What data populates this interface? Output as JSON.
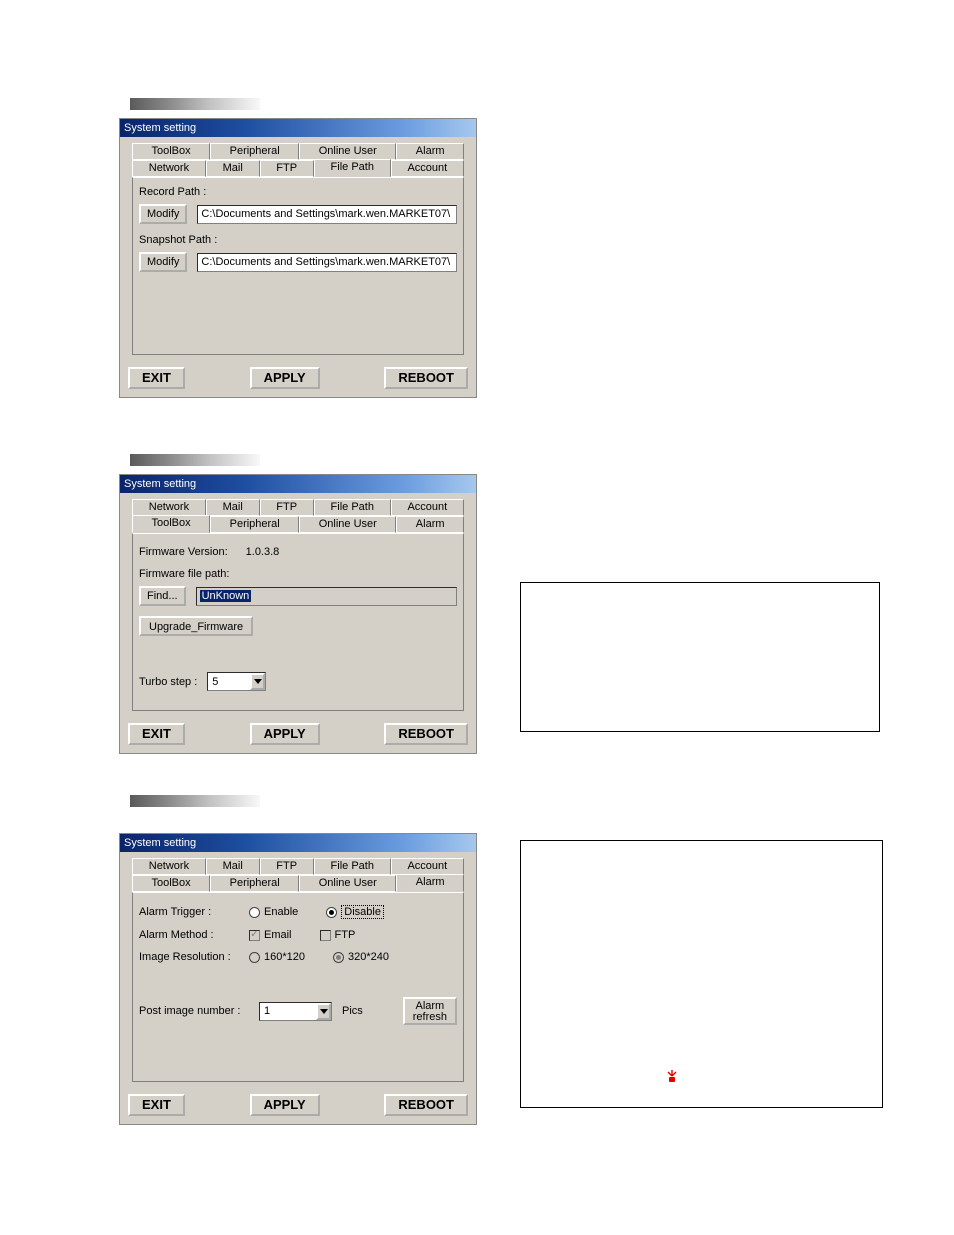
{
  "dlg1": {
    "title": "System setting",
    "tabs_row1": [
      "ToolBox",
      "Peripheral",
      "Online User",
      "Alarm"
    ],
    "tabs_row2": [
      "Network",
      "Mail",
      "FTP",
      "File Path",
      "Account"
    ],
    "active_tab": "File Path",
    "record_label": "Record Path :",
    "snapshot_label": "Snapshot Path :",
    "modify": "Modify",
    "record_path": "C:\\Documents and Settings\\mark.wen.MARKET07\\",
    "snapshot_path": "C:\\Documents and Settings\\mark.wen.MARKET07\\",
    "exit": "EXIT",
    "apply": "APPLY",
    "reboot": "REBOOT"
  },
  "dlg2": {
    "title": "System setting",
    "tabs_row1": [
      "Network",
      "Mail",
      "FTP",
      "File Path",
      "Account"
    ],
    "tabs_row2": [
      "ToolBox",
      "Peripheral",
      "Online User",
      "Alarm"
    ],
    "active_tab": "ToolBox",
    "fw_ver_label": "Firmware Version:",
    "fw_ver": "1.0.3.8",
    "fw_path_label": "Firmware file path:",
    "find": "Find...",
    "fw_path": "UnKnown",
    "upgrade": "Upgrade_Firmware",
    "turbo_label": "Turbo step :",
    "turbo_value": "5",
    "exit": "EXIT",
    "apply": "APPLY",
    "reboot": "REBOOT"
  },
  "dlg3": {
    "title": "System setting",
    "tabs_row1": [
      "Network",
      "Mail",
      "FTP",
      "File Path",
      "Account"
    ],
    "tabs_row2": [
      "ToolBox",
      "Peripheral",
      "Online User",
      "Alarm"
    ],
    "active_tab": "Alarm",
    "trigger_label": "Alarm Trigger :",
    "enable": "Enable",
    "disable": "Disable",
    "method_label": "Alarm Method :",
    "email": "Email",
    "ftp": "FTP",
    "res_label": "Image Resolution :",
    "res1": "160*120",
    "res2": "320*240",
    "post_label": "Post image number :",
    "post_value": "1",
    "pics": "Pics",
    "alarm_refresh": "Alarm\nrefresh",
    "exit": "EXIT",
    "apply": "APPLY",
    "reboot": "REBOOT"
  },
  "icon_name": "alarm-icon"
}
